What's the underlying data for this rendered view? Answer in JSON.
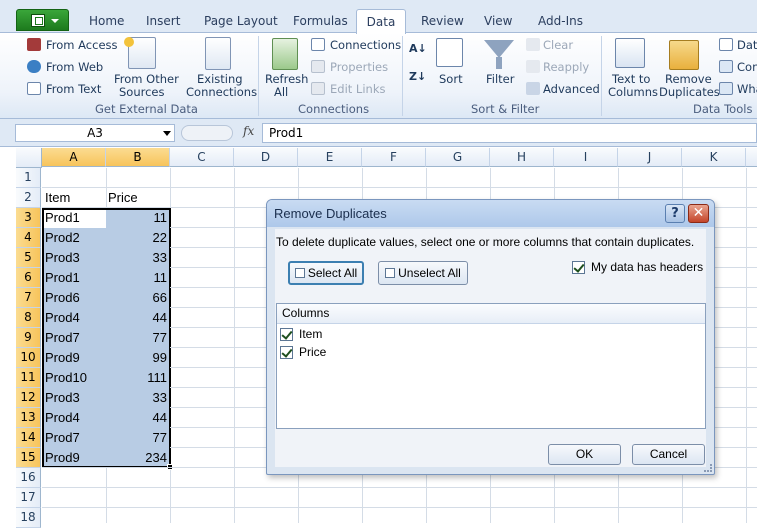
{
  "tabs": [
    "Home",
    "Insert",
    "Page Layout",
    "Formulas",
    "Data",
    "Review",
    "View",
    "Add-Ins"
  ],
  "active_tab": "Data",
  "ribbon": {
    "get_external": {
      "from_access": "From Access",
      "from_web": "From Web",
      "from_text": "From Text",
      "from_other_1": "From Other",
      "from_other_2": "Sources",
      "existing_1": "Existing",
      "existing_2": "Connections",
      "label": "Get External Data"
    },
    "connections": {
      "refresh_1": "Refresh",
      "refresh_2": "All",
      "connections": "Connections",
      "properties": "Properties",
      "edit_links": "Edit Links",
      "label": "Connections"
    },
    "sort_filter": {
      "sort": "Sort",
      "filter": "Filter",
      "clear": "Clear",
      "reapply": "Reapply",
      "advanced": "Advanced",
      "label": "Sort & Filter"
    },
    "data_tools": {
      "text_to_1": "Text to",
      "text_to_2": "Columns",
      "remove_1": "Remove",
      "remove_2": "Duplicates",
      "data_val": "Data",
      "consolidate": "Con",
      "whatif": "Wha",
      "label": "Data Tools"
    }
  },
  "formula_bar": {
    "name_box": "A3",
    "fx": "fx",
    "formula": "Prod1"
  },
  "columns": [
    "A",
    "B",
    "C",
    "D",
    "E",
    "F",
    "G",
    "H",
    "I",
    "J",
    "K"
  ],
  "rows": [
    "1",
    "2",
    "3",
    "4",
    "5",
    "6",
    "7",
    "8",
    "9",
    "10",
    "11",
    "12",
    "13",
    "14",
    "15",
    "16",
    "17",
    "18"
  ],
  "headers": {
    "item": "Item",
    "price": "Price"
  },
  "data_rows": [
    {
      "item": "Prod1",
      "price": "11"
    },
    {
      "item": "Prod2",
      "price": "22"
    },
    {
      "item": "Prod3",
      "price": "33"
    },
    {
      "item": "Prod1",
      "price": "11"
    },
    {
      "item": "Prod6",
      "price": "66"
    },
    {
      "item": "Prod4",
      "price": "44"
    },
    {
      "item": "Prod7",
      "price": "77"
    },
    {
      "item": "Prod9",
      "price": "99"
    },
    {
      "item": "Prod10",
      "price": "111"
    },
    {
      "item": "Prod3",
      "price": "33"
    },
    {
      "item": "Prod4",
      "price": "44"
    },
    {
      "item": "Prod7",
      "price": "77"
    },
    {
      "item": "Prod9",
      "price": "234"
    }
  ],
  "dialog": {
    "title": "Remove Duplicates",
    "help": "?",
    "close": "✕",
    "instructions": "To delete duplicate values, select one or more columns that contain duplicates.",
    "select_all": "Select All",
    "unselect_all": "Unselect All",
    "my_data_headers": "My data has headers",
    "columns_header": "Columns",
    "col_items": [
      "Item",
      "Price"
    ],
    "ok": "OK",
    "cancel": "Cancel"
  },
  "colors": {
    "selection": "#b8cce4",
    "header_selected": "#f7c45b",
    "file_green": "#1d7a1d"
  }
}
